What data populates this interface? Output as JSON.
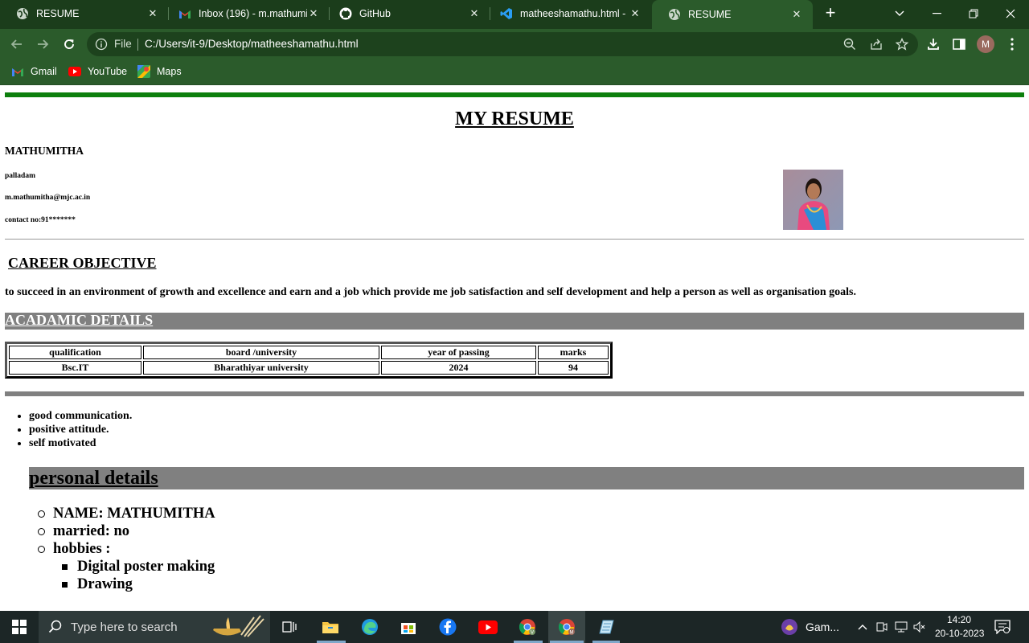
{
  "browser": {
    "tabs": [
      {
        "label": "RESUME",
        "icon": "globe-icon",
        "active": false
      },
      {
        "label": "Inbox (196) - m.mathumi",
        "icon": "gmail-icon",
        "active": false
      },
      {
        "label": "GitHub",
        "icon": "github-icon",
        "active": false
      },
      {
        "label": "matheeshamathu.html - '",
        "icon": "vscode-icon",
        "active": false
      },
      {
        "label": "RESUME",
        "icon": "globe-icon",
        "active": true
      }
    ],
    "address": {
      "scheme_label": "File",
      "url": "C:/Users/it-9/Desktop/matheeshamathu.html"
    },
    "profile_initial": "M",
    "bookmarks": [
      {
        "label": "Gmail",
        "icon": "gmail-icon"
      },
      {
        "label": "YouTube",
        "icon": "youtube-icon"
      },
      {
        "label": "Maps",
        "icon": "maps-icon"
      }
    ]
  },
  "resume": {
    "heading": "MY RESUME",
    "name": "MATHUMITHA",
    "location": "palladam",
    "email": "m.mathumitha@mjc.ac.in",
    "contact": "contact no:91*******",
    "career_heading": "CAREER OBJECTIVE",
    "career_text": "to succeed in an environment of growth and excellence and earn and a job which provide me job satisfaction and self development and help a person as well as organisation goals.",
    "academic_heading": "ACADAMIC DETAILS",
    "academic_table": {
      "headers": [
        "qualification",
        "board /university",
        "year of passing",
        "marks"
      ],
      "rows": [
        [
          "Bsc.IT",
          "Bharathiyar university",
          "2024",
          "94"
        ]
      ]
    },
    "skills": [
      "good communication.",
      "positive attitude.",
      "self motivated"
    ],
    "personal_heading": "personal details",
    "personal": {
      "name": "NAME: MATHUMITHA",
      "married": "married: no",
      "hobbies_label": "hobbies :",
      "hobbies": [
        "Digital poster making",
        "Drawing"
      ]
    }
  },
  "taskbar": {
    "search_placeholder": "Type here to search",
    "game_label": "Gam...",
    "time": "14:20",
    "date": "20-10-2023"
  },
  "colors": {
    "chrome_bg": "#2b5b2b",
    "tab_strip": "#1b3d1b",
    "green_rule": "#0d7f0d",
    "band_gray": "#808080"
  }
}
